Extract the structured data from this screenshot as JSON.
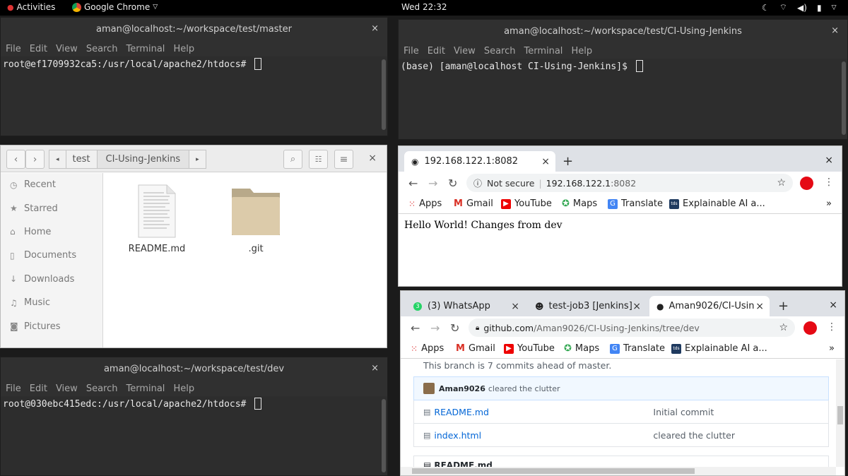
{
  "topbar": {
    "activities": "Activities",
    "app_name": "Google Chrome",
    "clock": "Wed 22:32",
    "tray_icons": [
      "night-mode-icon",
      "wifi-icon",
      "volume-icon",
      "battery-icon",
      "system-menu-chevron-icon"
    ]
  },
  "terminals": {
    "master": {
      "title": "aman@localhost:~/workspace/test/master",
      "prompt": "root@ef1709932ca5:/usr/local/apache2/htdocs# "
    },
    "jenkins": {
      "title": "aman@localhost:~/workspace/test/CI-Using-Jenkins",
      "prompt": "(base) [aman@localhost CI-Using-Jenkins]$ "
    },
    "dev": {
      "title": "aman@localhost:~/workspace/test/dev",
      "prompt": "root@030ebc415edc:/usr/local/apache2/htdocs# "
    },
    "menu": [
      "File",
      "Edit",
      "View",
      "Search",
      "Terminal",
      "Help"
    ],
    "close_glyph": "×"
  },
  "files": {
    "breadcrumb": [
      "test",
      "CI-Using-Jenkins"
    ],
    "sidebar": [
      {
        "icon": "clock-icon",
        "glyph": "◷",
        "label": "Recent"
      },
      {
        "icon": "star-icon",
        "glyph": "★",
        "label": "Starred"
      },
      {
        "icon": "home-icon",
        "glyph": "⌂",
        "label": "Home"
      },
      {
        "icon": "document-icon",
        "glyph": "▯",
        "label": "Documents"
      },
      {
        "icon": "download-icon",
        "glyph": "↓",
        "label": "Downloads"
      },
      {
        "icon": "music-icon",
        "glyph": "♫",
        "label": "Music"
      },
      {
        "icon": "camera-icon",
        "glyph": "◙",
        "label": "Pictures"
      }
    ],
    "items": [
      {
        "label": "README.md",
        "kind": "text-file"
      },
      {
        "label": ".git",
        "kind": "folder"
      }
    ]
  },
  "chrome_top": {
    "tab_title": "192.168.122.1:8082",
    "security": "Not secure",
    "url_host": "192.168.122.1",
    "url_port": ":8082",
    "page_text": "Hello World! Changes from dev"
  },
  "bookmarks": [
    {
      "icon": "apps-icon",
      "label": "Apps"
    },
    {
      "icon": "gmail-icon",
      "label": "Gmail"
    },
    {
      "icon": "youtube-icon",
      "label": "YouTube"
    },
    {
      "icon": "maps-icon",
      "label": "Maps"
    },
    {
      "icon": "translate-icon",
      "label": "Translate"
    },
    {
      "icon": "tds-icon",
      "label": "Explainable AI a..."
    }
  ],
  "bookmarks_more": "»",
  "chrome_bottom": {
    "tabs": [
      "(3) WhatsApp",
      "test-job3 [Jenkins]",
      "Aman9026/CI-Usin"
    ],
    "url_host": "github.com",
    "url_path": "/Aman9026/CI-Using-Jenkins/tree/dev",
    "branch_note": "This branch is 7 commits ahead of master.",
    "commit_author": "Aman9026",
    "commit_message": "cleared the clutter",
    "files": [
      {
        "name": "README.md",
        "message": "Initial commit"
      },
      {
        "name": "index.html",
        "message": "cleared the clutter"
      }
    ],
    "partial_heading": "README.md"
  },
  "colors": {
    "terminal_bg": "#2d2d2d",
    "chrome_tabstrip": "#dee1e6",
    "github_link": "#0366d6",
    "avatar": "#e50914"
  }
}
